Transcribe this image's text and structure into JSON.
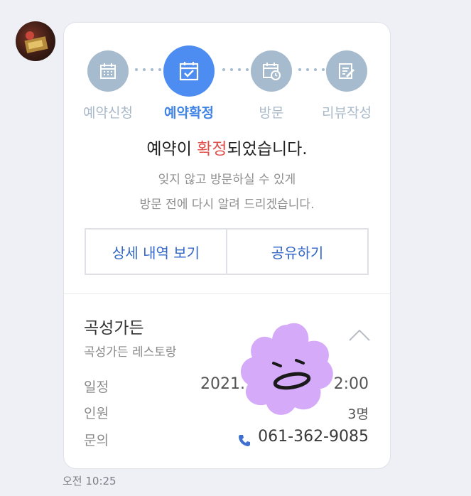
{
  "avatar": {
    "icon": "profile-photo"
  },
  "steps": [
    {
      "label": "예약신청",
      "icon": "calendar-icon",
      "active": false
    },
    {
      "label": "예약확정",
      "icon": "calendar-check-icon",
      "active": true
    },
    {
      "label": "방문",
      "icon": "calendar-clock-icon",
      "active": false
    },
    {
      "label": "리뷰작성",
      "icon": "edit-note-icon",
      "active": false
    }
  ],
  "headline": {
    "prefix": "예약이 ",
    "highlight": "확정",
    "suffix": "되었습니다."
  },
  "subtext": {
    "line1": "잊지 않고 방문하실 수 있게",
    "line2": "방문 전에 다시 알려 드리겠습니다."
  },
  "buttons": {
    "details": "상세 내역 보기",
    "share": "공유하기"
  },
  "place": {
    "name": "곡성가든",
    "subtitle": "곡성가든 레스토랑"
  },
  "info": {
    "schedule_label": "일정",
    "schedule_value": "2021. 4.",
    "schedule_time": "2:00",
    "people_label": "인원",
    "people_value": "3명",
    "contact_label": "문의",
    "contact_value": "061-362-9085"
  },
  "timestamp": "오전 10:25",
  "colors": {
    "accent": "#4d8df1",
    "inactive": "#a7bbcf",
    "highlight": "#e0504d",
    "sticker": "#d4aaf9"
  }
}
